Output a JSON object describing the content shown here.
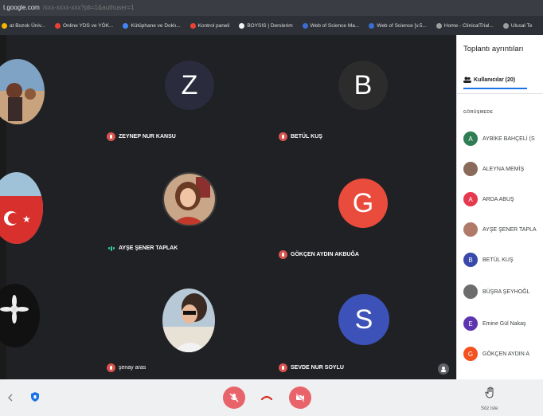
{
  "browser": {
    "url": "t.google.com",
    "url_tail": "/xxx-xxxx-xxx?pli=1&authuser=1",
    "bookmarks": [
      {
        "label": "at Bozok Üniv...",
        "color": "#f4b400"
      },
      {
        "label": "Online YDS ve YÖK...",
        "color": "#e94235"
      },
      {
        "label": "Kütüphane ve Doklı...",
        "color": "#4285f4"
      },
      {
        "label": "Kontrol paneli",
        "color": "#e94235"
      },
      {
        "label": "BOYSIS | Derslerim",
        "color": "#f2f2f2"
      },
      {
        "label": "Web of Science Ma...",
        "color": "#3b6ccf"
      },
      {
        "label": "Web of Science [v.5...",
        "color": "#3b6ccf"
      },
      {
        "label": "Home - ClinicalTrial...",
        "color": "#9e9e9e"
      },
      {
        "label": "Ulusal Te",
        "color": "#9e9e9e"
      }
    ]
  },
  "meeting": {
    "participants": [
      {
        "name": "ZEYNEP NUR KANSU",
        "initial": "Z",
        "color": "#2a2b3d",
        "muted": true
      },
      {
        "name": "BETÜL KUŞ",
        "initial": "B",
        "color": "#2c2c2c",
        "muted": true
      },
      {
        "name": "AYŞE ŞENER TAPLAK",
        "initial": "",
        "color": "",
        "muted": false,
        "speaking": true
      },
      {
        "name": "GÖKÇEN AYDIN AKBUĞA",
        "initial": "G",
        "color": "#e94b3c",
        "muted": true
      },
      {
        "name": "şenay aras",
        "initial": "",
        "color": "",
        "muted": true
      },
      {
        "name": "SEVDE NUR SOYLU",
        "initial": "S",
        "color": "#3d52b8",
        "muted": true
      }
    ]
  },
  "controls": {
    "present_label": "Söz iste"
  },
  "panel": {
    "title": "Toplantı ayrıntıları",
    "tab_label": "Kullanıcılar (20)",
    "section_label": "GÖRÜŞMEDE",
    "people": [
      {
        "name": "AYBİKE BAHÇELİ (S",
        "initial": "A",
        "color": "#2e7d55"
      },
      {
        "name": "ALEYNA MEMİŞ",
        "initial": "",
        "color": "#8a6a5a"
      },
      {
        "name": "ARDA ABUŞ",
        "initial": "A",
        "color": "#e53950"
      },
      {
        "name": "AYŞE ŞENER TAPLA",
        "initial": "",
        "color": "#b07a68"
      },
      {
        "name": "BETÜL KUŞ",
        "initial": "B",
        "color": "#3949ab"
      },
      {
        "name": "BÜŞRA ŞEYHOĞL",
        "initial": "",
        "color": "#6d6d6d"
      },
      {
        "name": "Emine Gül Nakaş",
        "initial": "E",
        "color": "#5e35b1"
      },
      {
        "name": "GÖKÇEN AYDIN A",
        "initial": "G",
        "color": "#f4511e"
      }
    ]
  }
}
